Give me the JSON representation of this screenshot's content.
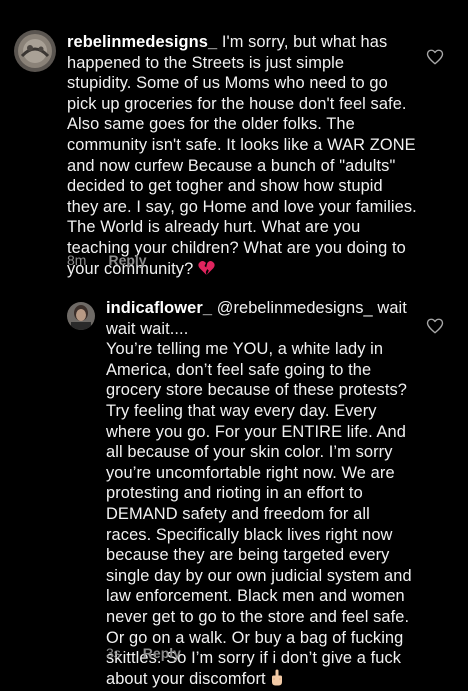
{
  "comments": [
    {
      "username": "rebelinmedesigns_",
      "lines": [
        "I'm sorry, but what has",
        "happened to the Streets is just simple",
        "stupidity. Some of us Moms who need to go",
        "pick up groceries for the house don't feel safe.",
        "Also same goes for the older folks. The",
        "community isn't safe. It looks like a WAR ZONE",
        "and now  curfew Because a bunch of \"adults\"",
        "decided to get togher and show how stupid",
        "they are. I say, go Home and love your families.",
        "The World is already hurt. What are you",
        "teaching your children? What are you doing to",
        "your community?"
      ],
      "emoji": "broken-heart-icon",
      "time": "8m",
      "reply_label": "Reply"
    },
    {
      "username": "indicaflower_",
      "lines": [
        "@rebelinmedesigns_ wait",
        "wait wait....",
        "You’re telling me YOU, a white lady in",
        "America, don’t feel safe going to the",
        "grocery store because of these protests?",
        "Try feeling that way every day. Every",
        "where you go. For your ENTIRE life. And",
        "all because of your skin color. I’m sorry",
        "you’re uncomfortable right now. We are",
        "protesting and rioting in an effort to",
        "DEMAND safety and freedom for all",
        "races. Specifically black lives right now",
        "because they are being targeted every",
        "single day by our own judicial system and",
        "law enforcement. Black men and women",
        "never get to go to the store and feel safe.",
        "Or go on a walk. Or buy a bag of fucking",
        "skittles. So I’m sorry if i don’t give a fuck",
        "about your discomfort"
      ],
      "emoji": "middle-finger-icon",
      "time": "3s",
      "reply_label": "Reply"
    }
  ],
  "colors": {
    "background": "#000000",
    "text": "#f2f2f2",
    "meta": "#8e8e8e",
    "heart_outline": "#a8a8a8"
  }
}
